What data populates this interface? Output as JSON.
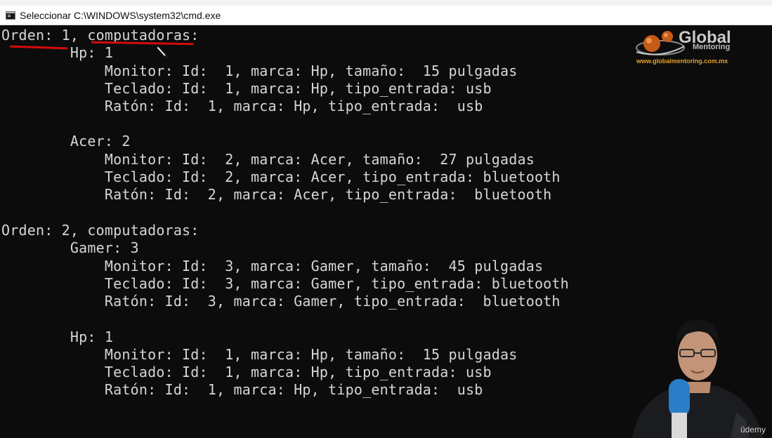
{
  "window": {
    "title": "Seleccionar C:\\WINDOWS\\system32\\cmd.exe",
    "icon": "cmd-icon"
  },
  "console": {
    "lines": [
      "Orden: 1, computadoras:",
      "        Hp: 1",
      "            Monitor: Id:  1, marca: Hp, tamaño:  15 pulgadas",
      "            Teclado: Id:  1, marca: Hp, tipo_entrada: usb",
      "            Ratón: Id:  1, marca: Hp, tipo_entrada:  usb",
      "",
      "        Acer: 2",
      "            Monitor: Id:  2, marca: Acer, tamaño:  27 pulgadas",
      "            Teclado: Id:  2, marca: Acer, tipo_entrada: bluetooth",
      "            Ratón: Id:  2, marca: Acer, tipo_entrada:  bluetooth",
      "",
      "Orden: 2, computadoras:",
      "        Gamer: 3",
      "            Monitor: Id:  3, marca: Gamer, tamaño:  45 pulgadas",
      "            Teclado: Id:  3, marca: Gamer, tipo_entrada: bluetooth",
      "            Ratón: Id:  3, marca: Gamer, tipo_entrada:  bluetooth",
      "",
      "        Hp: 1",
      "            Monitor: Id:  1, marca: Hp, tamaño:  15 pulgadas",
      "            Teclado: Id:  1, marca: Hp, tipo_entrada: usb",
      "            Ratón: Id:  1, marca: Hp, tipo_entrada:  usb"
    ]
  },
  "overlay": {
    "logo_word": "Global",
    "logo_sub": "Mentoring",
    "logo_url": "www.globalmentoring.com.mx",
    "udemy": "ûdemy",
    "annotation_color": "#d40b0b",
    "logo_accent": "#e07a1f"
  }
}
